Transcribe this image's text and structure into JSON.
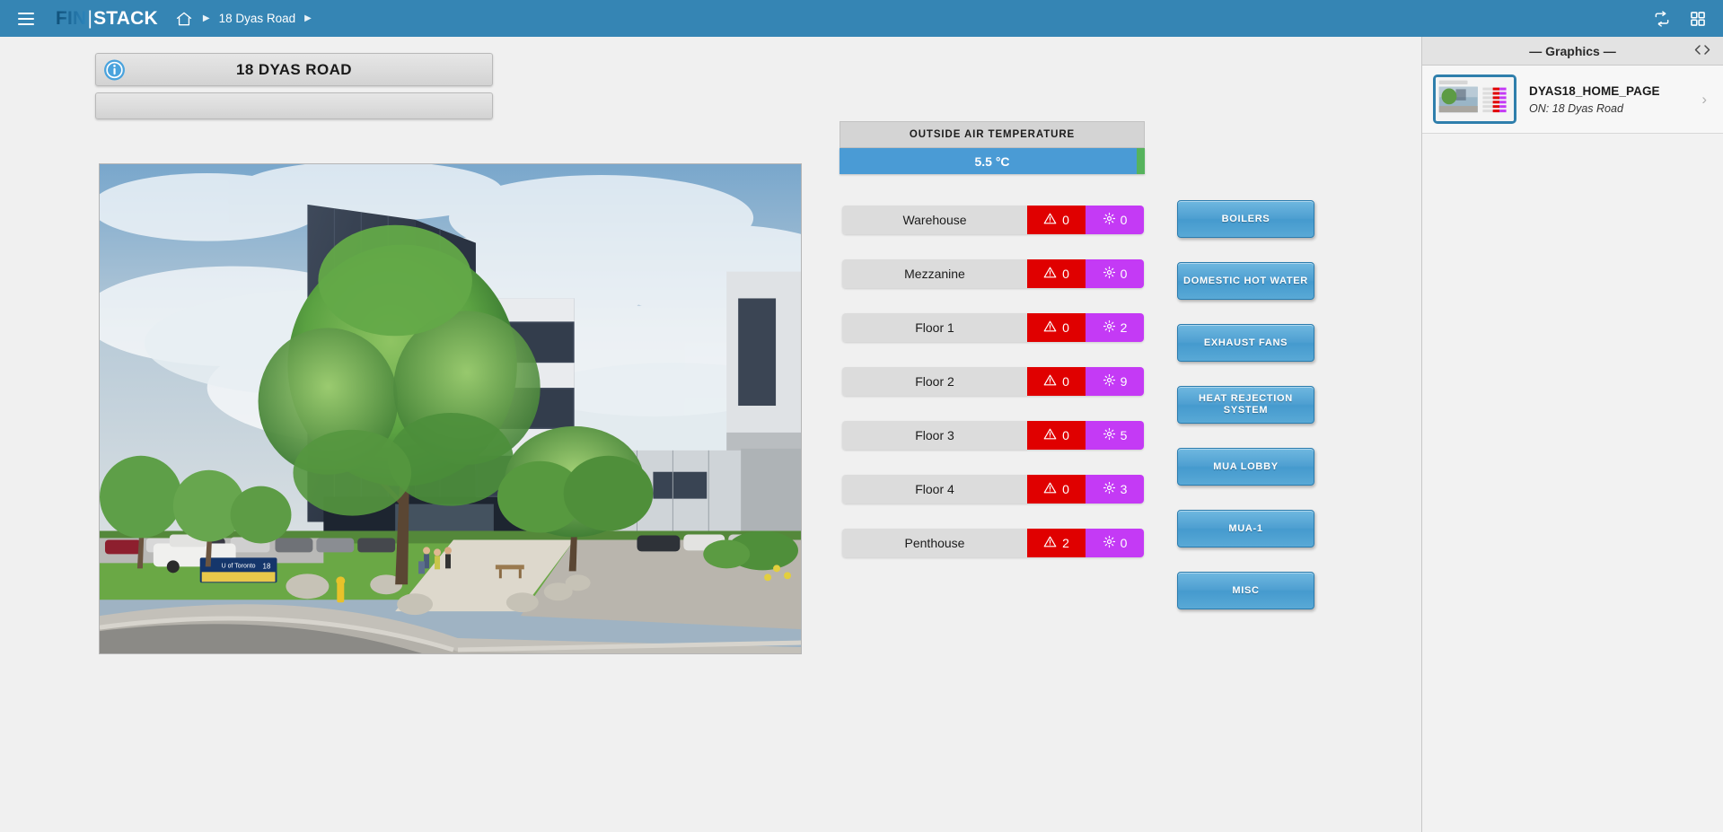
{
  "topbar": {
    "menu_icon": "hamburger-icon",
    "brand_fin": "FIN",
    "brand_sep": "|",
    "brand_stack": "STACK",
    "home_icon": "home-icon",
    "crumb_arrow_1": "▶",
    "breadcrumb": "18 Dyas Road",
    "crumb_arrow_2": "▶",
    "refresh_icon": "refresh-repeat-icon",
    "grid_icon": "grid-apps-icon",
    "bg_color": "#3585b4"
  },
  "page": {
    "title": "18 DYAS ROAD",
    "info_icon": "info-circle-icon",
    "subtitle": ""
  },
  "oat": {
    "label": "OUTSIDE AIR TEMPERATURE",
    "value": "5.5 °C",
    "bar_color": "#4a9bd5",
    "cap_color": "#56b35d"
  },
  "floors": {
    "alarm_icon": "warning-triangle-icon",
    "override_icon": "gear-icon",
    "alarm_color": "#e00000",
    "override_color": "#c43af5",
    "rows": [
      {
        "name": "Warehouse",
        "alarms": "0",
        "overrides": "0"
      },
      {
        "name": "Mezzanine",
        "alarms": "0",
        "overrides": "0"
      },
      {
        "name": "Floor 1",
        "alarms": "0",
        "overrides": "2"
      },
      {
        "name": "Floor 2",
        "alarms": "0",
        "overrides": "9"
      },
      {
        "name": "Floor 3",
        "alarms": "0",
        "overrides": "5"
      },
      {
        "name": "Floor 4",
        "alarms": "0",
        "overrides": "3"
      },
      {
        "name": "Penthouse",
        "alarms": "2",
        "overrides": "0"
      }
    ]
  },
  "equipment_buttons": [
    {
      "label": "BOILERS"
    },
    {
      "label": "DOMESTIC HOT WATER"
    },
    {
      "label": "EXHAUST FANS"
    },
    {
      "label": "HEAT REJECTION SYSTEM"
    },
    {
      "label": "MUA LOBBY"
    },
    {
      "label": "MUA-1"
    },
    {
      "label": "MISC"
    }
  ],
  "right_panel": {
    "title": "— Graphics —",
    "code_icon": "code-brackets-icon",
    "items": [
      {
        "name": "DYAS18_HOME_PAGE",
        "subtitle": "ON: 18 Dyas Road",
        "chevron": "›",
        "thumbnail": "home-page-thumbnail"
      }
    ]
  },
  "photo": {
    "alt": "street-view-of-office-building-with-tree"
  }
}
